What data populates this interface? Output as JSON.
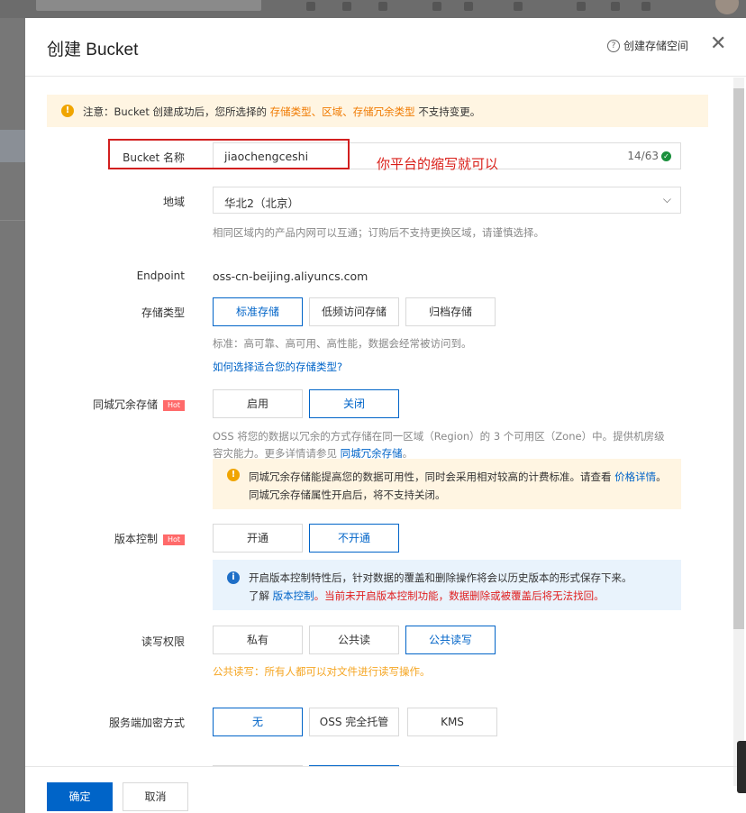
{
  "dialog": {
    "title": "创建 Bucket",
    "help_link": "创建存储空间",
    "close_glyph": "✕"
  },
  "notice": {
    "prefix": "注意：Bucket 创建成功后，您所选择的",
    "highlight": "存储类型、区域、存储冗余类型",
    "suffix": "不支持变更。"
  },
  "bucket_name": {
    "label": "Bucket 名称",
    "value": "jiaochengceshi",
    "counter": "14/63",
    "annotation": "你平台的缩写就可以"
  },
  "region": {
    "label": "地域",
    "value": "华北2（北京）",
    "hint": "相同区域内的产品内网可以互通；订购后不支持更换区域，请谨慎选择。"
  },
  "endpoint": {
    "label": "Endpoint",
    "value": "oss-cn-beijing.aliyuncs.com"
  },
  "storage_class": {
    "label": "存储类型",
    "options": [
      "标准存储",
      "低频访问存储",
      "归档存储"
    ],
    "selected": "标准存储",
    "hint": "标准：高可靠、高可用、高性能，数据会经常被访问到。",
    "link": "如何选择适合您的存储类型?"
  },
  "zrs": {
    "label": "同城冗余存储",
    "badge": "Hot",
    "options": [
      "启用",
      "关闭"
    ],
    "selected": "关闭",
    "desc_line1": "OSS 将您的数据以冗余的方式存储在同一区域（Region）的 3 个可用区（Zone）中。提供机房级",
    "desc_line2": "容灾能力。更多详情请参见",
    "desc_link": "同城冗余存储",
    "desc_end": "。",
    "tip_text": "同城冗余存储能提高您的数据可用性，同时会采用相对较高的计费标准。请查看",
    "tip_link": "价格详情",
    "tip_end": "。同城冗余存储属性开启后，将不支持关闭。"
  },
  "versioning": {
    "label": "版本控制",
    "badge": "Hot",
    "options": [
      "开通",
      "不开通"
    ],
    "selected": "不开通",
    "tip_line1": "开启版本控制特性后，针对数据的覆盖和删除操作将会以历史版本的形式保存下来。",
    "tip_prefix": "了解",
    "tip_link": "版本控制",
    "tip_warning": "。当前未开启版本控制功能，数据删除或被覆盖后将无法找回。"
  },
  "acl": {
    "label": "读写权限",
    "options": [
      "私有",
      "公共读",
      "公共读写"
    ],
    "selected": "公共读写",
    "hint": "公共读写：所有人都可以对文件进行读写操作。"
  },
  "encryption": {
    "label": "服务端加密方式",
    "options": [
      "无",
      "OSS 完全托管",
      "KMS"
    ],
    "selected": "无"
  },
  "footer": {
    "confirm": "确定",
    "cancel": "取消"
  },
  "colors": {
    "accent": "#0064c8",
    "warning": "#f07a00",
    "annotation": "#d91e18"
  }
}
